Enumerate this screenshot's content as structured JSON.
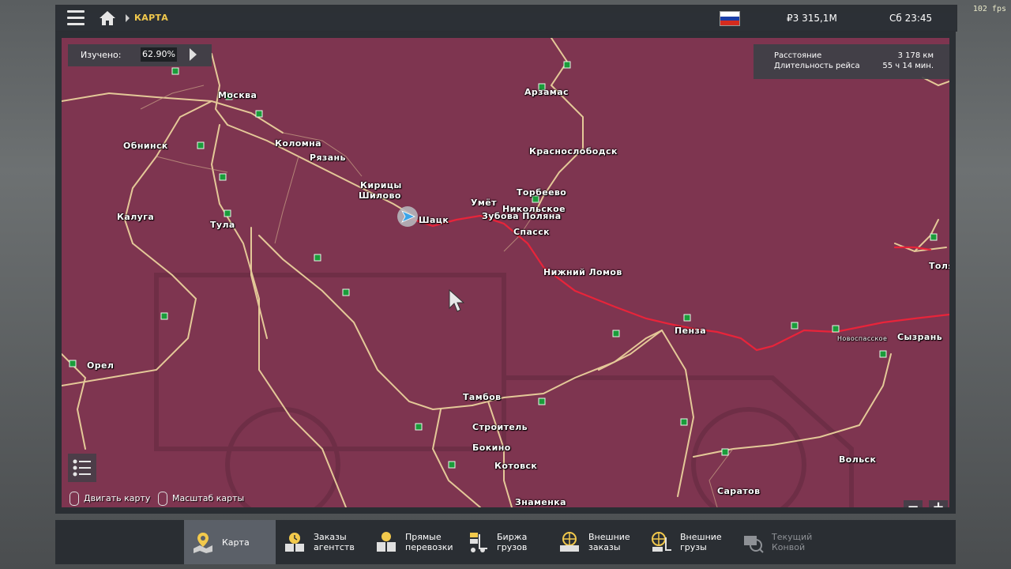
{
  "fps": "102 fps",
  "topbar": {
    "breadcrumb": "КАРТА",
    "money": "₽3 315,1M",
    "clock": "Сб 23:45",
    "flag_colors": [
      "#ffffff",
      "#1c3fa8",
      "#d52b1e"
    ]
  },
  "map": {
    "explored_label": "Изучено:",
    "explored_value": "62.90%",
    "distance_label": "Расстояние",
    "distance_value": "3 178 км",
    "duration_label": "Длительность рейса",
    "duration_value": "55 ч 14 мин.",
    "hint_move": "Двигать карту",
    "hint_zoom": "Масштаб карты",
    "zoom_out": "−",
    "zoom_in": "+",
    "cities": {
      "moscow": "Москва",
      "obninsk": "Обнинск",
      "kolomna": "Коломна",
      "ryazan": "Рязань",
      "kiritsy": "Кирицы",
      "shilovo": "Шилово",
      "shatsk": "Шацк",
      "kaluga": "Калуга",
      "tula": "Тула",
      "arzamas": "Арзамас",
      "krasnoslobodsk": "Краснослободск",
      "torbeevo": "Торбеево",
      "umet": "Умёт",
      "nikolskoe": "Никольское",
      "zubova_polyana": "Зубова Поляна",
      "spassk": "Спасск",
      "nizhny_lomov": "Нижний Ломов",
      "penza": "Пенза",
      "novospasskoe": "Новоспасское",
      "syzran": "Сызрань",
      "tolyatti": "Толя",
      "orel": "Орел",
      "tambov": "Тамбов",
      "stroitel": "Строитель",
      "bokino": "Бокино",
      "kotovsk": "Котовск",
      "znamenka": "Знаменка",
      "volsk": "Вольск",
      "saratov": "Саратов"
    }
  },
  "nav": [
    {
      "label": "Карта"
    },
    {
      "label": "Заказы\nагентств"
    },
    {
      "label": "Прямые\nперевозки"
    },
    {
      "label": "Биржа\nгрузов"
    },
    {
      "label": "Внешние\nзаказы"
    },
    {
      "label": "Внешние\nгрузы"
    },
    {
      "label": "Текущий\nКонвой"
    }
  ],
  "colors": {
    "map_bg": "#7e3550",
    "road": "#f0d9a0",
    "route": "#e8243a",
    "accent": "#f2c94c"
  }
}
